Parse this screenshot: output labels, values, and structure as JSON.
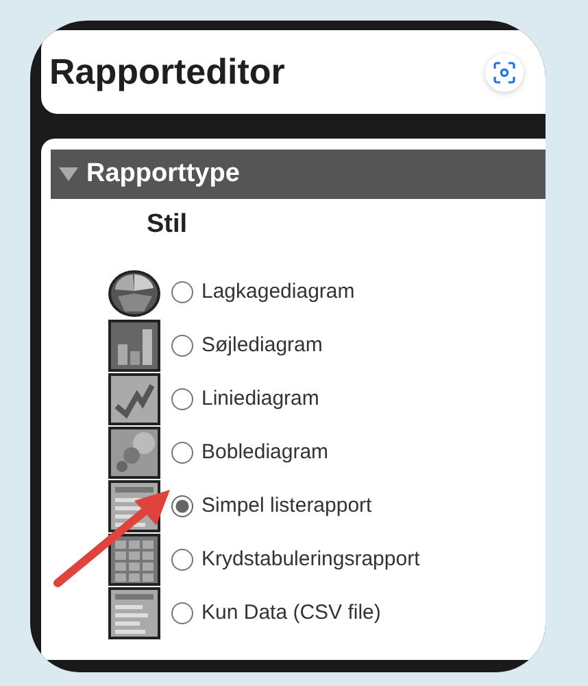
{
  "header": {
    "title": "Rapporteditor"
  },
  "section": {
    "title": "Rapporttype",
    "expanded": true,
    "group_label": "Stil",
    "options": [
      {
        "kind": "pie",
        "label": "Lagkagediagram",
        "selected": false
      },
      {
        "kind": "bar",
        "label": "Søjlediagram",
        "selected": false
      },
      {
        "kind": "line",
        "label": "Liniediagram",
        "selected": false
      },
      {
        "kind": "bubble",
        "label": "Boblediagram",
        "selected": false
      },
      {
        "kind": "list",
        "label": "Simpel listerapport",
        "selected": true
      },
      {
        "kind": "crosstab",
        "label": "Krydstabuleringsrapport",
        "selected": false
      },
      {
        "kind": "list",
        "label": "Kun Data (CSV file)",
        "selected": false
      }
    ]
  }
}
